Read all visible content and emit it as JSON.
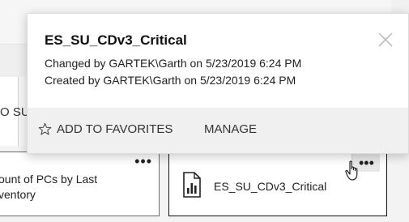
{
  "background": {
    "left_card_text": "O SU",
    "tile_left": {
      "text": "ount of PCs by Last ventory",
      "line1": "ount of PCs by Last",
      "line2": "ventory"
    },
    "tile_right": {
      "title": "ES_SU_CDv3_Critical"
    },
    "more_label": "•••"
  },
  "popup": {
    "title": "ES_SU_CDv3_Critical",
    "changed": "Changed by GARTEK\\Garth on 5/23/2019 6:24 PM",
    "created": "Created by GARTEK\\Garth on 5/23/2019 6:24 PM",
    "favorites_label": "ADD TO FAVORITES",
    "manage_label": "MANAGE"
  },
  "icons": {
    "close": "close-icon",
    "star": "star-outline-icon",
    "report": "report-icon",
    "cursor": "hand-pointer-icon"
  },
  "colors": {
    "popup_bg": "#ffffff",
    "footer_bg": "#f0f0f0",
    "page_bg": "#f3f3f3"
  }
}
